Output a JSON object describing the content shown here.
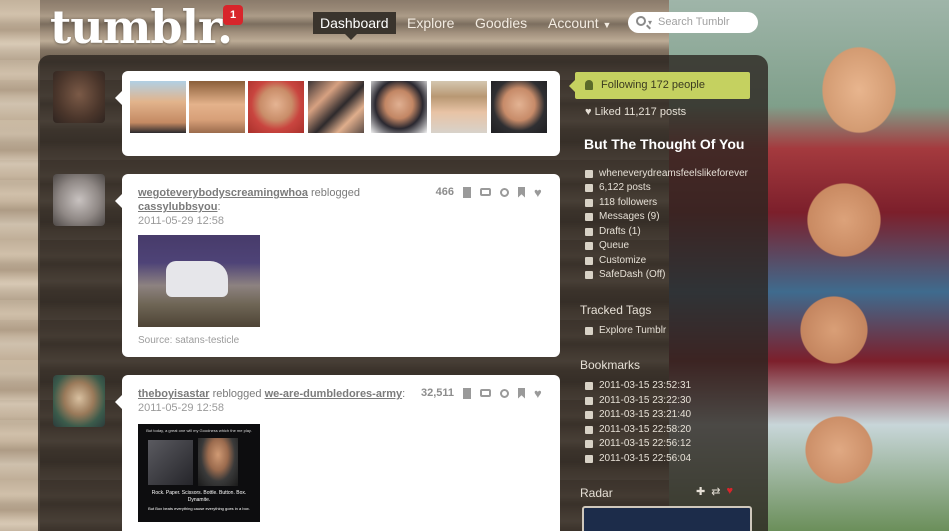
{
  "header": {
    "logo": "tumblr.",
    "notification_count": "1",
    "nav": [
      "Dashboard",
      "Explore",
      "Goodies",
      "Account"
    ],
    "search_placeholder": "Search Tumblr"
  },
  "posts": [
    {
      "user": "wegoteverybodyscreamingwhoa",
      "action": "reblogged",
      "source": "cassylubbsyou",
      "date": "2011-05-29 12:58",
      "notes": "466",
      "caption": "Source: satans-testicle"
    },
    {
      "user": "theboyisastar",
      "action": "reblogged",
      "source": "we-are-dumbledores-army",
      "date": "2011-05-29 12:58",
      "notes": "32,511",
      "image_text": [
        "But today, a great one will my Goodness which the me play.",
        "Rock. Paper. Scissors. Bottle. Button. Box. Dynamite.",
        "But Box beats everything cause everything goes in a box."
      ]
    }
  ],
  "sidebar": {
    "following": "Following 172 people",
    "liked": "Liked 11,217 posts",
    "blog_title": "But The Thought Of You",
    "blog_items": [
      "wheneverydreamsfeelslikeforever",
      "6,122 posts",
      "118 followers",
      "Messages (9)",
      "Drafts (1)",
      "Queue",
      "Customize",
      "SafeDash (Off)"
    ],
    "tracked_tags_title": "Tracked Tags",
    "explore_link": "Explore Tumblr",
    "bookmarks_title": "Bookmarks",
    "bookmarks": [
      "2011-03-15 23:52:31",
      "2011-03-15 23:22:30",
      "2011-03-15 23:21:40",
      "2011-03-15 22:58:20",
      "2011-03-15 22:56:12",
      "2011-03-15 22:56:04"
    ],
    "radar_title": "Radar"
  },
  "colors": {
    "accent_green": "#c5d160",
    "badge_red": "#d8252b"
  }
}
